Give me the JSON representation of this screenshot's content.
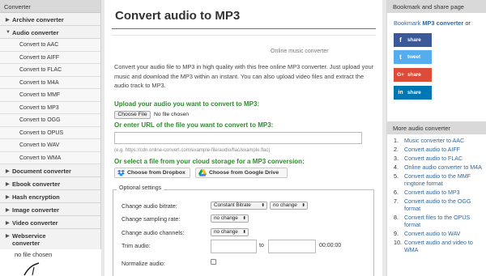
{
  "sidebar": {
    "header": "Converter",
    "items": [
      {
        "label": "Archive converter",
        "arrow": "▶"
      },
      {
        "label": "Audio converter",
        "arrow": "▼",
        "children": [
          "Convert to AAC",
          "Convert to AIFF",
          "Convert to FLAC",
          "Convert to M4A",
          "Convert to MMF",
          "Convert to MP3",
          "Convert to OGG",
          "Convert to OPUS",
          "Convert to WAV",
          "Convert to WMA"
        ]
      },
      {
        "label": "Document converter",
        "arrow": "▶"
      },
      {
        "label": "Ebook converter",
        "arrow": "▶"
      },
      {
        "label": "Hash encryption",
        "arrow": "▶"
      },
      {
        "label": "Image converter",
        "arrow": "▶"
      },
      {
        "label": "Video converter",
        "arrow": "▶"
      },
      {
        "label": "Webservice converter",
        "arrow": "▶"
      }
    ],
    "extra_note": "no file chosen"
  },
  "main": {
    "title": "Convert audio to MP3",
    "tagline": "Online music converter",
    "intro": "Convert your audio file to MP3 in high quality with this free online MP3 converter. Just upload your music and download the MP3 within an instant. You can also upload video files and extract the audio track to MP3.",
    "upload_heading": "Upload your audio you want to convert to MP3:",
    "choose_file": "Choose File",
    "no_file": "No file chosen",
    "url_heading": "Or enter URL of the file you want to convert to MP3:",
    "url_example": "(e.g. https://cdn.online-convert.com/example-file/audio/flac/example.flac)",
    "cloud_heading": "Or select a file from your cloud storage for a MP3 conversion:",
    "dropbox_btn": "Choose from Dropbox",
    "gdrive_btn": "Choose from Google Drive",
    "optional": {
      "legend": "Optional settings",
      "bitrate_label": "Change audio bitrate:",
      "bitrate_mode": "Constant Bitrate",
      "bitrate_value": "no change",
      "sampling_label": "Change sampling rate:",
      "sampling_value": "no change",
      "channels_label": "Change audio channels:",
      "channels_value": "no change",
      "trim_label": "Trim audio:",
      "trim_to": "to",
      "trim_time": "00:00:00",
      "normalize_label": "Normalize audio:"
    }
  },
  "right": {
    "bookmark_header": "Bookmark and share page",
    "bookmark_prefix": "Bookmark ",
    "bookmark_bold": "MP3 converter",
    "bookmark_suffix": " or",
    "share_buttons": [
      {
        "label": "share",
        "icon": "f",
        "color": "#3b5998"
      },
      {
        "label": "tweet",
        "icon": "t",
        "color": "#55acee"
      },
      {
        "label": "share",
        "icon": "G+",
        "color": "#dd4b39"
      },
      {
        "label": "share",
        "icon": "in",
        "color": "#0077b5"
      }
    ],
    "more_header": "More audio converter",
    "more_items": [
      "Music converter to AAC",
      "Convert audio to AIFF",
      "Convert audio to FLAC",
      "Online audio converter to M4A",
      "Convert audio to the MMF ringtone format",
      "Convert audio to MP3",
      "Convert audio to the OGG format",
      "Convert files to the OPUS format",
      "Convert audio to WAV",
      "Convert audio and video to WMA"
    ]
  }
}
